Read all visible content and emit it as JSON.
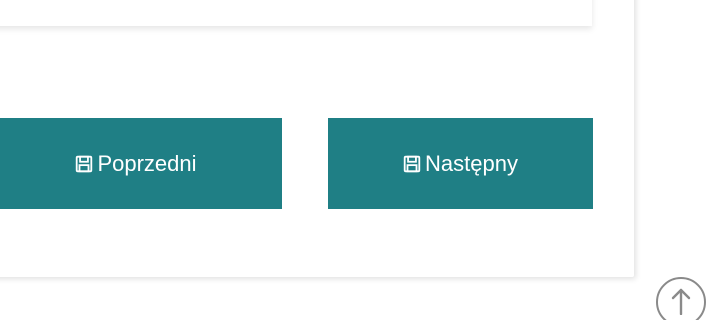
{
  "nav": {
    "prev_label": "Poprzedni",
    "next_label": "Następny",
    "icon": "floppy-disk-icon",
    "button_color": "#1f7f85"
  },
  "scroll_top": {
    "icon": "arrow-up-icon"
  }
}
